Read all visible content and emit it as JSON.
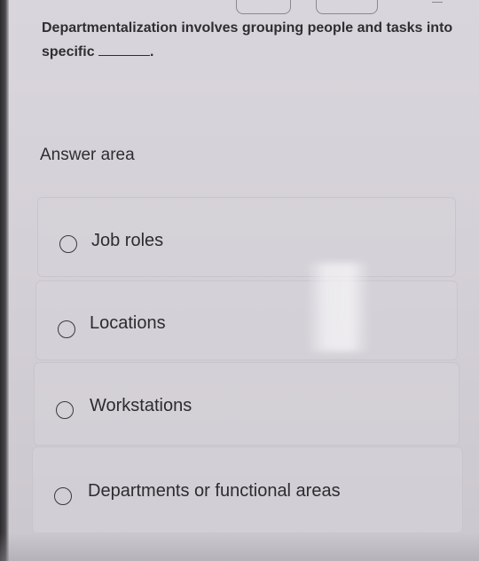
{
  "question": {
    "text_before_blank": "Departmentalization involves grouping people and tasks into specific",
    "text_after_blank": "."
  },
  "answer_area": {
    "title": "Answer area"
  },
  "options": [
    {
      "label": "Job roles",
      "selected": false
    },
    {
      "label": "Locations",
      "selected": false
    },
    {
      "label": "Workstations",
      "selected": false
    },
    {
      "label": "Departments or functional areas",
      "selected": false
    }
  ],
  "colors": {
    "background": "#d6d2d9",
    "text": "#2e2e30",
    "option_border": "#c9c5cc"
  }
}
